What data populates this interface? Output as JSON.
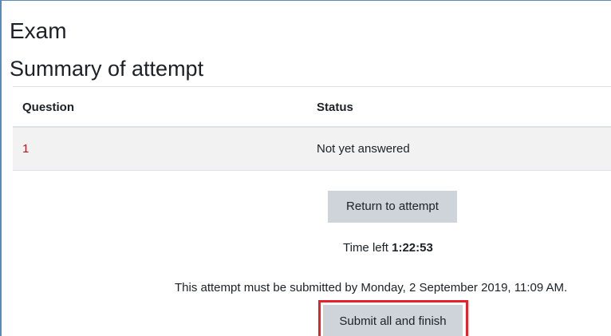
{
  "page": {
    "title": "Exam",
    "subtitle": "Summary of attempt"
  },
  "table": {
    "headers": {
      "question": "Question",
      "status": "Status"
    },
    "rows": [
      {
        "question": "1",
        "status": "Not yet answered"
      }
    ]
  },
  "actions": {
    "return_label": "Return to attempt",
    "submit_label": "Submit all and finish"
  },
  "timer": {
    "prefix": "Time left",
    "value": "1:22:53"
  },
  "deadline_text": "This attempt must be submitted by Monday, 2 September 2019, 11:09 AM.",
  "colors": {
    "link_red": "#b4171f",
    "button_gray": "#ced4da",
    "highlight_red": "#e8202a",
    "row_bg": "#f2f2f2"
  }
}
